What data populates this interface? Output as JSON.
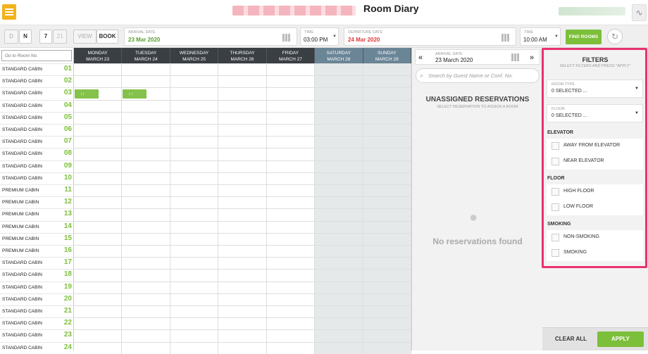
{
  "header": {
    "title": "Room Diary"
  },
  "toolbar": {
    "day_d": "D",
    "day_n": "N",
    "count_1": "7",
    "count_2": "21",
    "view_label": "VIEW",
    "book_label": "BOOK",
    "arrival_label": "ARRIVAL DATE",
    "arrival_value": "23 Mar 2020",
    "arrival_time_label": "TIME",
    "arrival_time_value": "03:00 PM",
    "departure_label": "DEPARTURE DATE",
    "departure_value": "24 Mar 2020",
    "departure_time_label": "TIME",
    "departure_time_value": "10:00 AM",
    "find_rooms": "FIND ROOMS"
  },
  "goto_placeholder": "Go to Room No.",
  "days": [
    {
      "name": "MONDAY",
      "date": "MARCH 23",
      "weekend": false
    },
    {
      "name": "TUESDAY",
      "date": "MARCH 24",
      "weekend": false
    },
    {
      "name": "WEDNESDAY",
      "date": "MARCH 25",
      "weekend": false
    },
    {
      "name": "THURSDAY",
      "date": "MARCH 26",
      "weekend": false
    },
    {
      "name": "FRIDAY",
      "date": "MARCH 27",
      "weekend": false
    },
    {
      "name": "SATURDAY",
      "date": "MARCH 28",
      "weekend": true
    },
    {
      "name": "SUNDAY",
      "date": "MARCH 29",
      "weekend": true
    }
  ],
  "rooms": [
    {
      "type": "STANDARD CABIN",
      "num": "01"
    },
    {
      "type": "STANDARD CABIN",
      "num": "02"
    },
    {
      "type": "STANDARD CABIN",
      "num": "03"
    },
    {
      "type": "STANDARD CABIN",
      "num": "04"
    },
    {
      "type": "STANDARD CABIN",
      "num": "05"
    },
    {
      "type": "STANDARD CABIN",
      "num": "06"
    },
    {
      "type": "STANDARD CABIN",
      "num": "07"
    },
    {
      "type": "STANDARD CABIN",
      "num": "08"
    },
    {
      "type": "STANDARD CABIN",
      "num": "09"
    },
    {
      "type": "STANDARD CABIN",
      "num": "10"
    },
    {
      "type": "PREMIUM CABIN",
      "num": "11"
    },
    {
      "type": "PREMIUM CABIN",
      "num": "12"
    },
    {
      "type": "PREMIUM CABIN",
      "num": "13"
    },
    {
      "type": "PREMIUM CABIN",
      "num": "14"
    },
    {
      "type": "PREMIUM CABIN",
      "num": "15"
    },
    {
      "type": "PREMIUM CABIN",
      "num": "16"
    },
    {
      "type": "STANDARD CABIN",
      "num": "17"
    },
    {
      "type": "STANDARD CABIN",
      "num": "18"
    },
    {
      "type": "STANDARD CABIN",
      "num": "19"
    },
    {
      "type": "STANDARD CABIN",
      "num": "20"
    },
    {
      "type": "STANDARD CABIN",
      "num": "21"
    },
    {
      "type": "STANDARD CABIN",
      "num": "22"
    },
    {
      "type": "STANDARD CABIN",
      "num": "23"
    },
    {
      "type": "STANDARD CABIN",
      "num": "24"
    }
  ],
  "bookings": [
    {
      "room_index": 2,
      "day_index": 0,
      "label": "↓↑"
    },
    {
      "room_index": 2,
      "day_index": 1,
      "label": "↓↑"
    }
  ],
  "unassigned": {
    "arrival_label": "ARRIVAL DATE",
    "arrival_value": "23 March 2020",
    "search_placeholder": "Search by Guest Name or Conf. No.",
    "title": "UNASSIGNED RESERVATIONS",
    "subtitle": "SELECT RESERVATION TO ASSIGN A ROOM",
    "empty": "No reservations found"
  },
  "filters": {
    "title": "FILTERS",
    "subtitle": "SELECT FILTERS AND PRESS \"APPLY\"",
    "room_type_label": "ROOM TYPE",
    "room_type_value": "0 SELECTED ...",
    "floor_label": "FLOOR",
    "floor_value": "0 SELECTED ...",
    "elevator_title": "ELEVATOR",
    "away_elevator": "AWAY FROM ELEVATOR",
    "near_elevator": "NEAR ELEVATOR",
    "floor_title": "FLOOR",
    "high_floor": "HIGH FLOOR",
    "low_floor": "LOW FLOOR",
    "smoking_title": "SMOKING",
    "non_smoking": "NON-SMOKING",
    "smoking": "SMOKING",
    "clear_all": "CLEAR ALL",
    "apply": "APPLY"
  },
  "colors": {
    "accent": "#7cbf3a",
    "highlight": "#e8326e",
    "menu": "#f3b21b",
    "departure": "#e03a3a"
  }
}
